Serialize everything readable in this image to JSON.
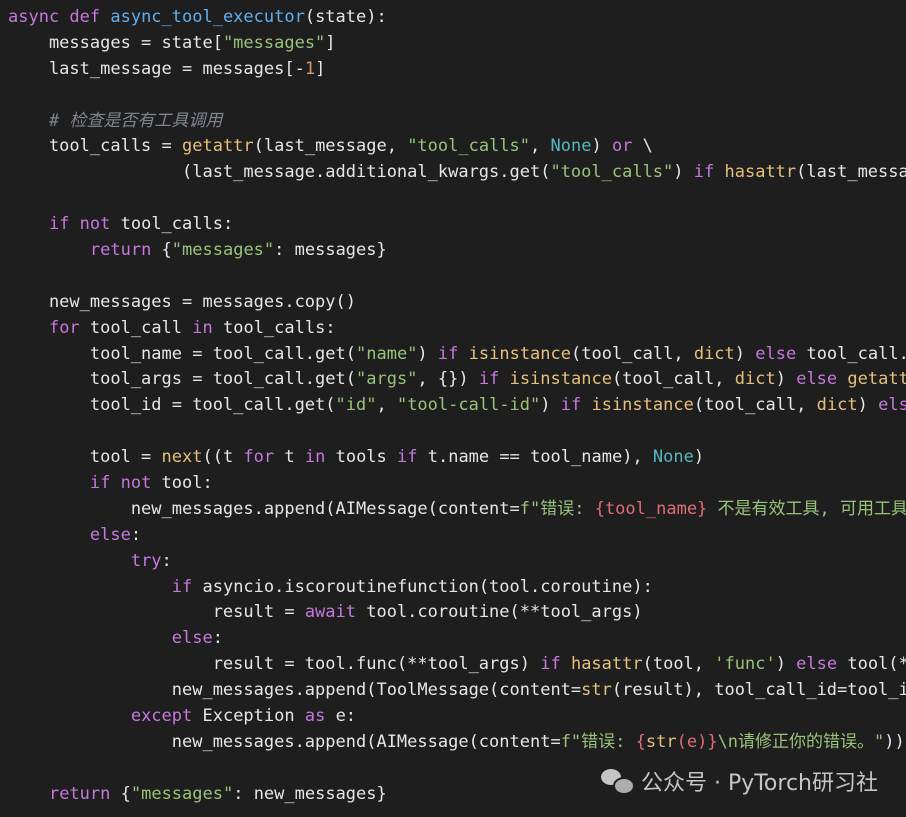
{
  "code_lines": [
    [
      {
        "t": "async def ",
        "c": "kw"
      },
      {
        "t": "async_tool_executor",
        "c": "fn"
      },
      {
        "t": "(state):",
        "c": "plain"
      }
    ],
    [
      {
        "t": "    messages = state[",
        "c": "plain"
      },
      {
        "t": "\"messages\"",
        "c": "str"
      },
      {
        "t": "]",
        "c": "plain"
      }
    ],
    [
      {
        "t": "    last_message = messages[-",
        "c": "plain"
      },
      {
        "t": "1",
        "c": "num"
      },
      {
        "t": "]",
        "c": "plain"
      }
    ],
    [],
    [
      {
        "t": "    # 检查是否有工具调用",
        "c": "cmt"
      }
    ],
    [
      {
        "t": "    tool_calls = ",
        "c": "plain"
      },
      {
        "t": "getattr",
        "c": "bi"
      },
      {
        "t": "(last_message, ",
        "c": "plain"
      },
      {
        "t": "\"tool_calls\"",
        "c": "str"
      },
      {
        "t": ", ",
        "c": "plain"
      },
      {
        "t": "None",
        "c": "const"
      },
      {
        "t": ") ",
        "c": "plain"
      },
      {
        "t": "or",
        "c": "kw"
      },
      {
        "t": " \\",
        "c": "plain"
      }
    ],
    [
      {
        "t": "                 (last_message.additional_kwargs.get(",
        "c": "plain"
      },
      {
        "t": "\"tool_calls\"",
        "c": "str"
      },
      {
        "t": ") ",
        "c": "plain"
      },
      {
        "t": "if",
        "c": "kw"
      },
      {
        "t": " ",
        "c": "plain"
      },
      {
        "t": "hasattr",
        "c": "bi"
      },
      {
        "t": "(last_message",
        "c": "plain"
      }
    ],
    [],
    [
      {
        "t": "    ",
        "c": "plain"
      },
      {
        "t": "if not",
        "c": "kw"
      },
      {
        "t": " tool_calls:",
        "c": "plain"
      }
    ],
    [
      {
        "t": "        ",
        "c": "plain"
      },
      {
        "t": "return",
        "c": "kw"
      },
      {
        "t": " {",
        "c": "plain"
      },
      {
        "t": "\"messages\"",
        "c": "str"
      },
      {
        "t": ": messages}",
        "c": "plain"
      }
    ],
    [],
    [
      {
        "t": "    new_messages = messages.copy()",
        "c": "plain"
      }
    ],
    [
      {
        "t": "    ",
        "c": "plain"
      },
      {
        "t": "for",
        "c": "kw"
      },
      {
        "t": " tool_call ",
        "c": "plain"
      },
      {
        "t": "in",
        "c": "kw"
      },
      {
        "t": " tool_calls:",
        "c": "plain"
      }
    ],
    [
      {
        "t": "        tool_name = tool_call.get(",
        "c": "plain"
      },
      {
        "t": "\"name\"",
        "c": "str"
      },
      {
        "t": ") ",
        "c": "plain"
      },
      {
        "t": "if",
        "c": "kw"
      },
      {
        "t": " ",
        "c": "plain"
      },
      {
        "t": "isinstance",
        "c": "bi"
      },
      {
        "t": "(tool_call, ",
        "c": "plain"
      },
      {
        "t": "dict",
        "c": "bi"
      },
      {
        "t": ") ",
        "c": "plain"
      },
      {
        "t": "else",
        "c": "kw"
      },
      {
        "t": " tool_call.",
        "c": "plain"
      }
    ],
    [
      {
        "t": "        tool_args = tool_call.get(",
        "c": "plain"
      },
      {
        "t": "\"args\"",
        "c": "str"
      },
      {
        "t": ", {}) ",
        "c": "plain"
      },
      {
        "t": "if",
        "c": "kw"
      },
      {
        "t": " ",
        "c": "plain"
      },
      {
        "t": "isinstance",
        "c": "bi"
      },
      {
        "t": "(tool_call, ",
        "c": "plain"
      },
      {
        "t": "dict",
        "c": "bi"
      },
      {
        "t": ") ",
        "c": "plain"
      },
      {
        "t": "else",
        "c": "kw"
      },
      {
        "t": " ",
        "c": "plain"
      },
      {
        "t": "getatt",
        "c": "bi"
      }
    ],
    [
      {
        "t": "        tool_id = tool_call.get(",
        "c": "plain"
      },
      {
        "t": "\"id\"",
        "c": "str"
      },
      {
        "t": ", ",
        "c": "plain"
      },
      {
        "t": "\"tool-call-id\"",
        "c": "str"
      },
      {
        "t": ") ",
        "c": "plain"
      },
      {
        "t": "if",
        "c": "kw"
      },
      {
        "t": " ",
        "c": "plain"
      },
      {
        "t": "isinstance",
        "c": "bi"
      },
      {
        "t": "(tool_call, ",
        "c": "plain"
      },
      {
        "t": "dict",
        "c": "bi"
      },
      {
        "t": ") ",
        "c": "plain"
      },
      {
        "t": "els",
        "c": "kw"
      }
    ],
    [],
    [
      {
        "t": "        tool = ",
        "c": "plain"
      },
      {
        "t": "next",
        "c": "bi"
      },
      {
        "t": "((t ",
        "c": "plain"
      },
      {
        "t": "for",
        "c": "kw"
      },
      {
        "t": " t ",
        "c": "plain"
      },
      {
        "t": "in",
        "c": "kw"
      },
      {
        "t": " tools ",
        "c": "plain"
      },
      {
        "t": "if",
        "c": "kw"
      },
      {
        "t": " t.name == tool_name), ",
        "c": "plain"
      },
      {
        "t": "None",
        "c": "const"
      },
      {
        "t": ")",
        "c": "plain"
      }
    ],
    [
      {
        "t": "        ",
        "c": "plain"
      },
      {
        "t": "if not",
        "c": "kw"
      },
      {
        "t": " tool:",
        "c": "plain"
      }
    ],
    [
      {
        "t": "            new_messages.append(AIMessage(content=",
        "c": "plain"
      },
      {
        "t": "f\"错误: ",
        "c": "str"
      },
      {
        "t": "{tool_name}",
        "c": "err"
      },
      {
        "t": " 不是有效工具, 可用工具",
        "c": "str"
      }
    ],
    [
      {
        "t": "        ",
        "c": "plain"
      },
      {
        "t": "else",
        "c": "kw"
      },
      {
        "t": ":",
        "c": "plain"
      }
    ],
    [
      {
        "t": "            ",
        "c": "plain"
      },
      {
        "t": "try",
        "c": "kw"
      },
      {
        "t": ":",
        "c": "plain"
      }
    ],
    [
      {
        "t": "                ",
        "c": "plain"
      },
      {
        "t": "if",
        "c": "kw"
      },
      {
        "t": " asyncio.iscoroutinefunction(tool.coroutine):",
        "c": "plain"
      }
    ],
    [
      {
        "t": "                    result = ",
        "c": "plain"
      },
      {
        "t": "await",
        "c": "kw"
      },
      {
        "t": " tool.coroutine(**tool_args)",
        "c": "plain"
      }
    ],
    [
      {
        "t": "                ",
        "c": "plain"
      },
      {
        "t": "else",
        "c": "kw"
      },
      {
        "t": ":",
        "c": "plain"
      }
    ],
    [
      {
        "t": "                    result = tool.func(**tool_args) ",
        "c": "plain"
      },
      {
        "t": "if",
        "c": "kw"
      },
      {
        "t": " ",
        "c": "plain"
      },
      {
        "t": "hasattr",
        "c": "bi"
      },
      {
        "t": "(tool, ",
        "c": "plain"
      },
      {
        "t": "'func'",
        "c": "str"
      },
      {
        "t": ") ",
        "c": "plain"
      },
      {
        "t": "else",
        "c": "kw"
      },
      {
        "t": " tool(*",
        "c": "plain"
      }
    ],
    [
      {
        "t": "                new_messages.append(ToolMessage(content=",
        "c": "plain"
      },
      {
        "t": "str",
        "c": "bi"
      },
      {
        "t": "(result), tool_call_id=tool_i",
        "c": "plain"
      }
    ],
    [
      {
        "t": "            ",
        "c": "plain"
      },
      {
        "t": "except",
        "c": "kw"
      },
      {
        "t": " Exception ",
        "c": "plain"
      },
      {
        "t": "as",
        "c": "kw"
      },
      {
        "t": " e:",
        "c": "plain"
      }
    ],
    [
      {
        "t": "                new_messages.append(AIMessage(content=",
        "c": "plain"
      },
      {
        "t": "f\"错误: ",
        "c": "str"
      },
      {
        "t": "{",
        "c": "err"
      },
      {
        "t": "str",
        "c": "bi"
      },
      {
        "t": "(e)}",
        "c": "err"
      },
      {
        "t": "\\n请修正你的错误。\"",
        "c": "str"
      },
      {
        "t": "))",
        "c": "plain"
      }
    ],
    [],
    [
      {
        "t": "    ",
        "c": "plain"
      },
      {
        "t": "return",
        "c": "kw"
      },
      {
        "t": " {",
        "c": "plain"
      },
      {
        "t": "\"messages\"",
        "c": "str"
      },
      {
        "t": ": new_messages}",
        "c": "plain"
      }
    ]
  ],
  "watermark": {
    "icon": "wechat-icon",
    "text": "公众号 · PyTorch研习社"
  }
}
